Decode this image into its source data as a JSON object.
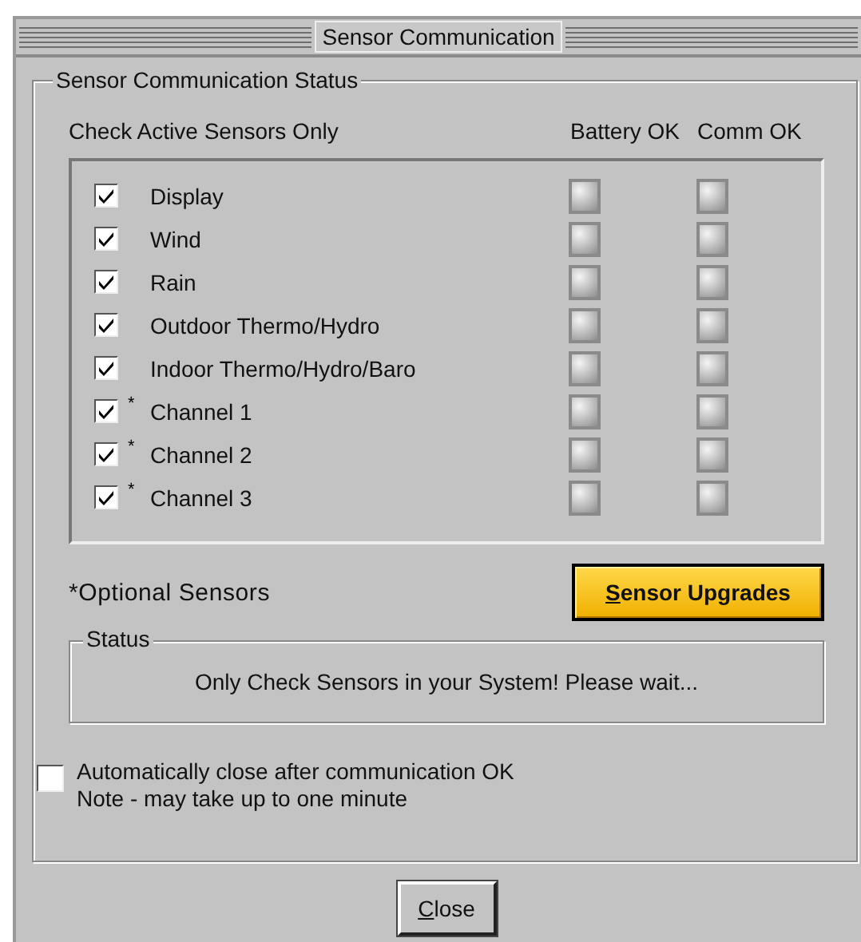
{
  "window": {
    "title": "Sensor Communication"
  },
  "group": {
    "title": "Sensor Communication Status",
    "check_header": "Check Active Sensors Only",
    "columns": [
      "Battery OK",
      "Comm OK"
    ]
  },
  "sensors": [
    {
      "name": "Display",
      "kind": "standard",
      "checked": true,
      "battery_ok": false,
      "comm_ok": false
    },
    {
      "name": "Wind",
      "kind": "standard",
      "checked": true,
      "battery_ok": false,
      "comm_ok": false
    },
    {
      "name": "Rain",
      "kind": "standard",
      "checked": true,
      "battery_ok": false,
      "comm_ok": false
    },
    {
      "name": "Outdoor Thermo/Hydro",
      "kind": "standard",
      "checked": true,
      "battery_ok": false,
      "comm_ok": false
    },
    {
      "name": "Indoor Thermo/Hydro/Baro",
      "kind": "standard",
      "checked": true,
      "battery_ok": false,
      "comm_ok": false
    },
    {
      "name": "Channel 1",
      "kind": "optional",
      "mark": "*",
      "checked": true,
      "battery_ok": false,
      "comm_ok": false
    },
    {
      "name": "Channel 2",
      "kind": "optional",
      "mark": "*",
      "checked": true,
      "battery_ok": false,
      "comm_ok": false
    },
    {
      "name": "Channel 3",
      "kind": "optional",
      "mark": "*",
      "checked": true,
      "battery_ok": false,
      "comm_ok": false
    }
  ],
  "optional_note": "*Optional Sensors",
  "upgrade_button": {
    "label": "Sensor Upgrades",
    "mnemonic_underlined": true
  },
  "status": {
    "title": "Status",
    "message": "Only Check Sensors in your System! Please wait..."
  },
  "auto_close": {
    "checked": false,
    "label": "Automatically close after communication OK",
    "note": "Note - may take up to one minute"
  },
  "close_button": {
    "label": "Close",
    "mnemonic_underlined": true
  }
}
